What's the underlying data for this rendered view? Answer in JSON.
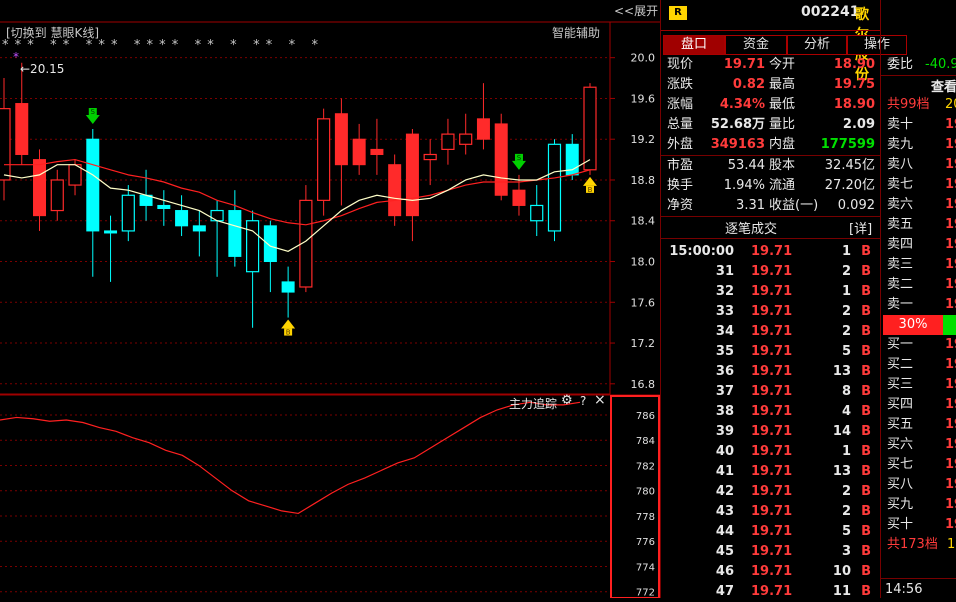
{
  "chart_header": {
    "switch_label": "[切换到 慧眼K线]",
    "assist_label": "智能辅助",
    "expand_label": "<<展开",
    "max_marker": "←20.15",
    "star_row": "* * *   * *   * * *   * * * *   * *   *   * *   *   *"
  },
  "main_axis": {
    "ticks": [
      "20.0",
      "19.6",
      "19.2",
      "18.8",
      "18.4",
      "18.0",
      "17.6",
      "17.2",
      "16.8"
    ]
  },
  "kline": {
    "ymin": 16.7,
    "ymax": 20.35,
    "candles": [
      {
        "o": 18.8,
        "c": 19.5,
        "h": 19.8,
        "l": 18.6,
        "color": "red"
      },
      {
        "o": 19.55,
        "c": 19.05,
        "h": 19.95,
        "l": 18.95,
        "color": "red"
      },
      {
        "o": 19.0,
        "c": 18.45,
        "h": 19.1,
        "l": 18.3,
        "color": "red"
      },
      {
        "o": 18.5,
        "c": 18.8,
        "h": 18.9,
        "l": 18.4,
        "color": "red"
      },
      {
        "o": 18.75,
        "c": 18.95,
        "h": 19.0,
        "l": 18.65,
        "color": "red"
      },
      {
        "o": 19.2,
        "c": 18.3,
        "h": 19.3,
        "l": 17.85,
        "color": "cyan"
      },
      {
        "o": 18.3,
        "c": 18.28,
        "h": 18.45,
        "l": 17.8,
        "color": "cyan"
      },
      {
        "o": 18.3,
        "c": 18.65,
        "h": 18.75,
        "l": 18.2,
        "color": "cyan"
      },
      {
        "o": 18.65,
        "c": 18.55,
        "h": 18.9,
        "l": 18.4,
        "color": "cyan"
      },
      {
        "o": 18.55,
        "c": 18.52,
        "h": 18.7,
        "l": 18.35,
        "color": "cyan"
      },
      {
        "o": 18.5,
        "c": 18.35,
        "h": 18.65,
        "l": 18.25,
        "color": "cyan"
      },
      {
        "o": 18.35,
        "c": 18.3,
        "h": 18.5,
        "l": 18.05,
        "color": "cyan"
      },
      {
        "o": 18.4,
        "c": 18.5,
        "h": 18.6,
        "l": 17.85,
        "color": "cyan"
      },
      {
        "o": 18.5,
        "c": 18.05,
        "h": 18.7,
        "l": 17.95,
        "color": "cyan"
      },
      {
        "o": 17.9,
        "c": 18.4,
        "h": 18.5,
        "l": 17.35,
        "color": "cyan"
      },
      {
        "o": 18.35,
        "c": 18.0,
        "h": 18.4,
        "l": 17.7,
        "color": "cyan"
      },
      {
        "o": 17.8,
        "c": 17.7,
        "h": 17.95,
        "l": 17.45,
        "color": "cyan"
      },
      {
        "o": 17.75,
        "c": 18.6,
        "h": 18.75,
        "l": 17.7,
        "color": "red"
      },
      {
        "o": 18.6,
        "c": 19.4,
        "h": 19.5,
        "l": 18.45,
        "color": "red"
      },
      {
        "o": 19.45,
        "c": 18.95,
        "h": 19.6,
        "l": 18.55,
        "color": "red"
      },
      {
        "o": 19.2,
        "c": 18.95,
        "h": 19.35,
        "l": 18.85,
        "color": "red"
      },
      {
        "o": 19.1,
        "c": 19.05,
        "h": 19.4,
        "l": 18.85,
        "color": "red"
      },
      {
        "o": 18.95,
        "c": 18.45,
        "h": 19.05,
        "l": 18.35,
        "color": "red"
      },
      {
        "o": 19.25,
        "c": 18.45,
        "h": 19.3,
        "l": 18.2,
        "color": "red"
      },
      {
        "o": 19.0,
        "c": 19.05,
        "h": 19.2,
        "l": 18.75,
        "color": "red"
      },
      {
        "o": 19.1,
        "c": 19.25,
        "h": 19.4,
        "l": 18.95,
        "color": "red"
      },
      {
        "o": 19.15,
        "c": 19.25,
        "h": 19.45,
        "l": 19.05,
        "color": "red"
      },
      {
        "o": 19.4,
        "c": 19.2,
        "h": 19.75,
        "l": 19.1,
        "color": "red"
      },
      {
        "o": 19.35,
        "c": 18.65,
        "h": 19.45,
        "l": 18.6,
        "color": "red"
      },
      {
        "o": 18.7,
        "c": 18.55,
        "h": 18.85,
        "l": 18.45,
        "color": "red"
      },
      {
        "o": 18.4,
        "c": 18.55,
        "h": 18.75,
        "l": 18.25,
        "color": "cyan"
      },
      {
        "o": 18.3,
        "c": 19.15,
        "h": 19.2,
        "l": 18.2,
        "color": "cyan"
      },
      {
        "o": 19.15,
        "c": 18.85,
        "h": 19.25,
        "l": 18.8,
        "color": "cyan"
      },
      {
        "o": 18.9,
        "c": 19.71,
        "h": 19.75,
        "l": 18.85,
        "color": "red"
      }
    ],
    "ma_short": [
      18.85,
      18.82,
      18.85,
      18.95,
      18.95,
      18.85,
      18.72,
      18.7,
      18.65,
      18.6,
      18.55,
      18.5,
      18.4,
      18.35,
      18.3,
      18.15,
      18.1,
      18.2,
      18.35,
      18.5,
      18.6,
      18.65,
      18.62,
      18.6,
      18.62,
      18.7,
      18.8,
      18.85,
      18.82,
      18.8,
      18.8,
      18.88,
      18.9,
      19.0
    ],
    "ma_long": [
      18.95,
      18.95,
      18.95,
      18.98,
      19.0,
      18.95,
      18.9,
      18.85,
      18.82,
      18.78,
      18.72,
      18.68,
      18.6,
      18.55,
      18.48,
      18.42,
      18.38,
      18.36,
      18.4,
      18.45,
      18.52,
      18.58,
      18.6,
      18.62,
      18.65,
      18.7,
      18.75,
      18.78,
      18.78,
      18.78,
      18.8,
      18.82,
      18.85,
      18.9
    ],
    "signals": [
      {
        "i": 5,
        "type": "down",
        "label": "S"
      },
      {
        "i": 16,
        "type": "up",
        "label": "B"
      },
      {
        "i": 29,
        "type": "down",
        "label": "S"
      },
      {
        "i": 33,
        "type": "up",
        "label": "B"
      }
    ]
  },
  "sub_chart": {
    "title": "主力追踪",
    "gear": "⚙",
    "help": "?",
    "close": "×",
    "ticks": [
      "786",
      "784",
      "782",
      "780",
      "778",
      "776",
      "774",
      "772"
    ],
    "ymin": 771.5,
    "ymax": 787.5,
    "line": [
      785.6,
      785.8,
      785.7,
      785.5,
      785.6,
      785.4,
      785.0,
      784.7,
      784.2,
      783.8,
      783.2,
      782.8,
      782.0,
      781.0,
      780.0,
      779.2,
      778.8,
      778.4,
      778.2,
      779.0,
      779.8,
      780.5,
      781.0,
      781.6,
      782.2,
      782.6,
      783.4,
      784.2,
      785.0,
      785.8,
      786.4,
      786.8,
      787.0,
      786.8,
      786.8,
      787.0
    ]
  },
  "quote": {
    "stock_code": "002241",
    "stock_name": "歌尔股份",
    "r_badge": "R",
    "tabs": [
      "盘口",
      "资金",
      "分析",
      "操作"
    ],
    "rows": [
      {
        "l1": "现价",
        "v1": "19.71",
        "c1": "red",
        "l2": "今开",
        "v2": "18.90",
        "c2": "red"
      },
      {
        "l1": "涨跌",
        "v1": "0.82",
        "c1": "red",
        "l2": "最高",
        "v2": "19.75",
        "c2": "red"
      },
      {
        "l1": "涨幅",
        "v1": "4.34%",
        "c1": "red",
        "l2": "最低",
        "v2": "18.90",
        "c2": "red"
      },
      {
        "l1": "总量",
        "v1": "52.68万",
        "c1": "white",
        "l2": "量比",
        "v2": "2.09",
        "c2": "white"
      },
      {
        "l1": "外盘",
        "v1": "349163",
        "c1": "red",
        "l2": "内盘",
        "v2": "177599",
        "c2": "green"
      }
    ],
    "rows2": [
      {
        "l1": "市盈",
        "v1": "53.44",
        "l2": "股本",
        "v2": "32.45亿"
      },
      {
        "l1": "换手",
        "v1": "1.94%",
        "l2": "流通",
        "v2": "27.20亿"
      },
      {
        "l1": "净资",
        "v1": "3.31",
        "l2": "收益(一)",
        "v2": "0.092"
      }
    ],
    "ticks_header": "逐笔成交",
    "ticks_detail": "[详]",
    "ticks": [
      {
        "t": "15:00:00",
        "p": "19.71",
        "v": "1",
        "s": "B"
      },
      {
        "t": "31",
        "p": "19.71",
        "v": "2",
        "s": "B"
      },
      {
        "t": "32",
        "p": "19.71",
        "v": "1",
        "s": "B"
      },
      {
        "t": "33",
        "p": "19.71",
        "v": "2",
        "s": "B"
      },
      {
        "t": "34",
        "p": "19.71",
        "v": "2",
        "s": "B"
      },
      {
        "t": "35",
        "p": "19.71",
        "v": "5",
        "s": "B"
      },
      {
        "t": "36",
        "p": "19.71",
        "v": "13",
        "s": "B"
      },
      {
        "t": "37",
        "p": "19.71",
        "v": "8",
        "s": "B"
      },
      {
        "t": "38",
        "p": "19.71",
        "v": "4",
        "s": "B"
      },
      {
        "t": "39",
        "p": "19.71",
        "v": "14",
        "s": "B"
      },
      {
        "t": "40",
        "p": "19.71",
        "v": "1",
        "s": "B"
      },
      {
        "t": "41",
        "p": "19.71",
        "v": "13",
        "s": "B"
      },
      {
        "t": "42",
        "p": "19.71",
        "v": "2",
        "s": "B"
      },
      {
        "t": "43",
        "p": "19.71",
        "v": "2",
        "s": "B"
      },
      {
        "t": "44",
        "p": "19.71",
        "v": "5",
        "s": "B"
      },
      {
        "t": "45",
        "p": "19.71",
        "v": "3",
        "s": "B"
      },
      {
        "t": "46",
        "p": "19.71",
        "v": "10",
        "s": "B"
      },
      {
        "t": "47",
        "p": "19.71",
        "v": "11",
        "s": "B"
      }
    ]
  },
  "order_book": {
    "weibi_label": "委比",
    "weibi_value": "-40.9",
    "view_label": "查看",
    "sell_total": "共99档",
    "sell_total_value": "20",
    "sells": [
      "卖十",
      "卖九",
      "卖八",
      "卖七",
      "卖六",
      "卖五",
      "卖四",
      "卖三",
      "卖二",
      "卖一"
    ],
    "sell_prices": [
      "19",
      "19",
      "19",
      "19",
      "19",
      "19",
      "19",
      "19",
      "19",
      "19"
    ],
    "ratio": "30%",
    "buys": [
      "买一",
      "买二",
      "买三",
      "买四",
      "买五",
      "买六",
      "买七",
      "买八",
      "买九",
      "买十"
    ],
    "buy_prices": [
      "19",
      "19",
      "19",
      "19",
      "19",
      "19",
      "19",
      "19",
      "19",
      "19"
    ],
    "buy_total": "共173档",
    "buy_total_value": "19",
    "time": "14:56"
  },
  "colors": {
    "up": "#ff2a2a",
    "down": "#00ffff",
    "grid": "#7a0000",
    "ma_short": "#ffffc8",
    "ma_long": "#ff2020"
  }
}
